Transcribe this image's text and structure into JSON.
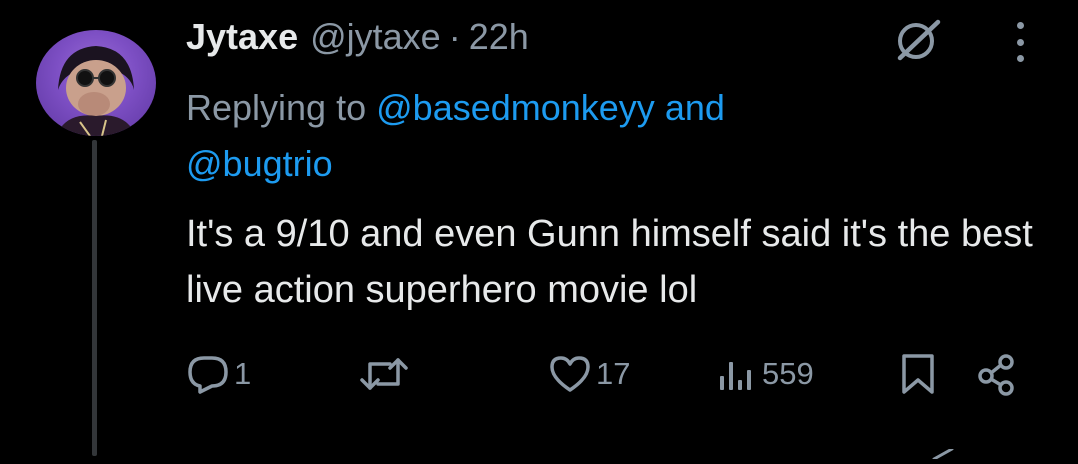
{
  "tweet": {
    "author_name": "Jytaxe",
    "author_handle": "@jytaxe",
    "separator": "·",
    "time": "22h",
    "reply_prefix": "Replying to",
    "reply_mention_1": "@basedmonkeyy",
    "reply_and": "and",
    "reply_mention_2": "@bugtrio",
    "text": "It's a 9/10 and even Gunn himself said it's the best live action superhero movie lol"
  },
  "actions": {
    "replies": "1",
    "reposts": "",
    "likes": "17",
    "views": "559"
  },
  "icons": {
    "reply": "reply-icon",
    "repost": "repost-icon",
    "like": "heart-icon",
    "views": "views-icon",
    "bookmark": "bookmark-icon",
    "share": "share-icon",
    "grok": "grok-icon",
    "more": "more-options-icon"
  },
  "colors": {
    "background": "#000000",
    "primary_text": "#e7e9ea",
    "secondary_text": "#8b98a5",
    "link": "#1d9bf0",
    "avatar_bg": "#7d4fc4"
  }
}
